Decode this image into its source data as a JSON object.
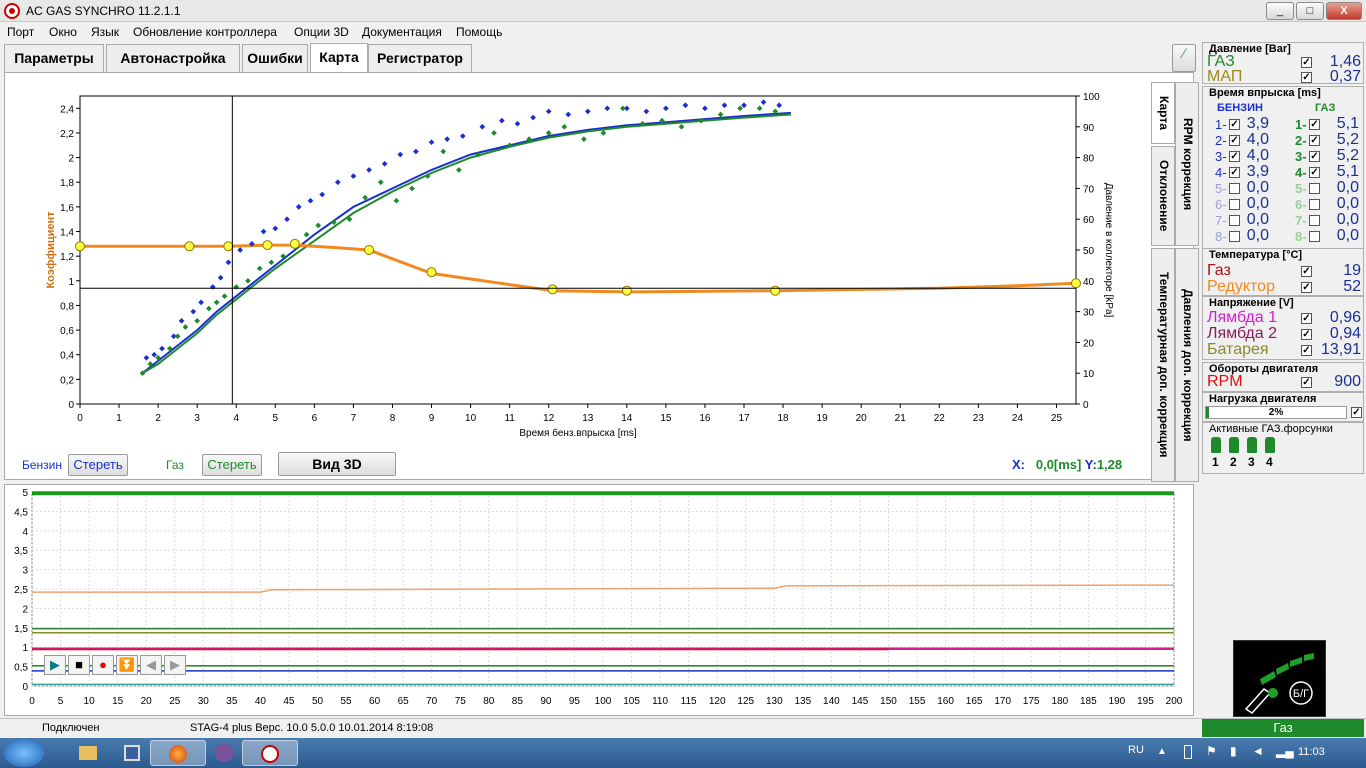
{
  "window": {
    "title": "AC GAS SYNCHRO  11.2.1.1",
    "min": "_",
    "max": "□",
    "close": "X"
  },
  "menu": [
    "Порт",
    "Окно",
    "Язык",
    "Обновление контроллера",
    "Опции 3D",
    "Документация",
    "Помощь"
  ],
  "tabs": [
    "Параметры",
    "Автонастройка",
    "Ошибки",
    "Карта",
    "Регистратор"
  ],
  "vtabs": [
    "Карта",
    "RPM коррекция",
    "Отклонение",
    "Давления доп. коррекция",
    "Температурная доп. коррекция"
  ],
  "map": {
    "ylabel": "Коэффициент",
    "xlabel": "Время бенз.впрыска [ms]",
    "y2label": "Давление в коллекторе [kPa]",
    "cursor": {
      "x_label": "X:",
      "x_value": "0,0[ms]",
      "y_label": "Y:",
      "y_value": "1,28"
    },
    "colors": {
      "petrol": "#1a2fcf",
      "gas": "#1f8a2b",
      "coef": "#f08a1e"
    }
  },
  "chart_data": [
    {
      "type": "scatter",
      "title": "",
      "xlabel": "Время бенз.впрыска [ms]",
      "ylabel": "Коэффициент",
      "y2label": "Давление в коллекторе [kPa]",
      "xlim": [
        0,
        25.5
      ],
      "ylim": [
        0,
        2.5
      ],
      "y2lim": [
        0,
        100
      ],
      "x_ticks": [
        0,
        1,
        2,
        3,
        4,
        5,
        6,
        7,
        8,
        9,
        10,
        11,
        12,
        13,
        14,
        15,
        16,
        17,
        18,
        19,
        20,
        21,
        22,
        23,
        24,
        25
      ],
      "y_ticks": [
        "0",
        "0,2",
        "0,4",
        "0,6",
        "0,8",
        "1",
        "1,2",
        "1,4",
        "1,6",
        "1,8",
        "2",
        "2,2",
        "2,4"
      ],
      "y2_ticks": [
        0,
        10,
        20,
        30,
        40,
        50,
        60,
        70,
        80,
        90,
        100
      ],
      "series": [
        {
          "name": "Бензин",
          "kind": "line",
          "x": [
            1.6,
            2,
            2.5,
            3,
            3.5,
            4,
            4.5,
            5,
            6,
            7,
            8,
            9,
            10,
            11,
            12,
            13,
            14,
            15,
            16,
            17,
            18.2
          ],
          "y2": [
            10,
            14,
            19,
            24,
            30,
            35,
            40,
            45,
            55,
            64,
            70,
            76,
            81,
            84,
            87,
            89,
            90.5,
            91.5,
            92.5,
            93.5,
            94.5
          ]
        },
        {
          "name": "Газ",
          "kind": "line",
          "x": [
            1.6,
            2,
            2.5,
            3,
            3.5,
            4,
            4.5,
            5,
            6,
            7,
            8,
            9,
            10,
            11,
            12,
            13,
            14,
            15,
            16,
            17,
            18.2
          ],
          "y2": [
            10,
            13,
            18,
            23,
            29,
            34,
            39,
            44,
            53,
            62,
            69,
            75,
            80,
            83.5,
            86.5,
            88.5,
            90,
            91,
            92,
            93,
            94
          ]
        },
        {
          "name": "Коэффициент",
          "kind": "line",
          "x": [
            0,
            2.8,
            3.8,
            4.8,
            5.5,
            6.5,
            7.4,
            9,
            12.1,
            14,
            17.8,
            20,
            22,
            24,
            25.5
          ],
          "y": [
            1.28,
            1.28,
            1.28,
            1.29,
            1.29,
            1.27,
            1.25,
            1.06,
            0.92,
            0.91,
            0.92,
            0.93,
            0.94,
            0.96,
            0.98
          ]
        },
        {
          "name": "Бензин",
          "kind": "points",
          "x": [
            1.7,
            1.9,
            2.1,
            2.4,
            2.6,
            2.9,
            3.1,
            3.4,
            3.6,
            3.8,
            4.1,
            4.4,
            4.7,
            5.0,
            5.3,
            5.6,
            5.9,
            6.2,
            6.6,
            7.0,
            7.4,
            7.8,
            8.2,
            8.6,
            9.0,
            9.4,
            9.8,
            10.3,
            10.8,
            11.2,
            11.6,
            12.0,
            12.5,
            13.0,
            13.5,
            14.0,
            14.5,
            15.0,
            15.5,
            16.0,
            16.5,
            17.0,
            17.5,
            17.9
          ],
          "y2": [
            15,
            16,
            18,
            22,
            27,
            30,
            33,
            38,
            41,
            46,
            50,
            52,
            56,
            57,
            60,
            64,
            66,
            68,
            72,
            74,
            76,
            78,
            81,
            82,
            85,
            86,
            87,
            90,
            92,
            91,
            93,
            95,
            94,
            95,
            96,
            96,
            95,
            96,
            97,
            96,
            97,
            97,
            98,
            97
          ]
        },
        {
          "name": "Газ",
          "kind": "points",
          "x": [
            1.6,
            1.8,
            2.0,
            2.3,
            2.5,
            2.7,
            3.0,
            3.3,
            3.5,
            3.7,
            4.0,
            4.3,
            4.6,
            4.9,
            5.2,
            5.5,
            5.8,
            6.1,
            6.5,
            6.9,
            7.3,
            7.7,
            8.1,
            8.5,
            8.9,
            9.3,
            9.7,
            10.2,
            10.6,
            11.0,
            11.5,
            12.0,
            12.4,
            12.9,
            13.4,
            13.9,
            14.4,
            14.9,
            15.4,
            15.9,
            16.4,
            16.9,
            17.4,
            17.8
          ],
          "y2": [
            10,
            13,
            15,
            18,
            22,
            25,
            27,
            31,
            33,
            35,
            38,
            40,
            44,
            46,
            48,
            52,
            55,
            58,
            59,
            60,
            67,
            72,
            66,
            70,
            74,
            82,
            76,
            81,
            88,
            84,
            86,
            88,
            90,
            86,
            88,
            96,
            91,
            92,
            90,
            92,
            94,
            96,
            96,
            95
          ]
        },
        {
          "name": "Коэффициент",
          "kind": "markers",
          "x": [
            0,
            2.8,
            3.8,
            4.8,
            5.5,
            7.4,
            9,
            12.1,
            14,
            17.8,
            25.5
          ],
          "y": [
            1.28,
            1.28,
            1.28,
            1.29,
            1.3,
            1.25,
            1.07,
            0.93,
            0.92,
            0.92,
            0.98
          ]
        }
      ],
      "crosshair": {
        "x": 3.9,
        "y": 0.94
      }
    },
    {
      "type": "line",
      "title": "",
      "xlim": [
        0,
        200
      ],
      "ylim": [
        0,
        5
      ],
      "x_ticks": [
        0,
        5,
        10,
        15,
        20,
        25,
        30,
        35,
        40,
        45,
        50,
        55,
        60,
        65,
        70,
        75,
        80,
        85,
        90,
        95,
        100,
        105,
        110,
        115,
        120,
        125,
        130,
        135,
        140,
        145,
        150,
        155,
        160,
        165,
        170,
        175,
        180,
        185,
        190,
        195,
        200
      ],
      "y_ticks": [
        "0",
        "0,5",
        "1",
        "1,5",
        "2",
        "2,5",
        "3",
        "3,5",
        "4",
        "4,5",
        "5"
      ],
      "series": [
        {
          "color": "#1a9a1a",
          "x": [
            0,
            200
          ],
          "y": [
            4.97,
            4.97
          ]
        },
        {
          "color": "#f0a070",
          "x": [
            0,
            40,
            42,
            130,
            132,
            200
          ],
          "y": [
            2.42,
            2.42,
            2.48,
            2.52,
            2.58,
            2.6
          ]
        },
        {
          "color": "#2c7a2c",
          "x": [
            0,
            200
          ],
          "y": [
            1.48,
            1.48
          ]
        },
        {
          "color": "#8a8a2a",
          "x": [
            0,
            200
          ],
          "y": [
            1.37,
            1.37
          ]
        },
        {
          "color": "#d21f8a",
          "x": [
            0,
            200
          ],
          "y": [
            0.96,
            0.96
          ]
        },
        {
          "color": "#e01010",
          "x": [
            0,
            150
          ],
          "y": [
            0.94,
            0.94
          ]
        },
        {
          "color": "#1f8a2b",
          "x": [
            0,
            200
          ],
          "y": [
            0.52,
            0.52
          ]
        },
        {
          "color": "#1a2fcf",
          "x": [
            0,
            200
          ],
          "y": [
            0.39,
            0.39
          ]
        },
        {
          "color": "#40a0a0",
          "x": [
            0,
            200
          ],
          "y": [
            0.04,
            0.04
          ]
        }
      ]
    }
  ],
  "mapcontrols": {
    "petrol_label": "Бензин",
    "petrol_clear": "Стереть",
    "gas_label": "Газ",
    "gas_clear": "Стереть",
    "view3d": "Вид 3D"
  },
  "pressure": {
    "header": "Давление [Bar]",
    "gas_label": "ГАЗ",
    "gas_value": "1,46",
    "map_label": "МАП",
    "map_value": "0,37"
  },
  "injection": {
    "header": "Время впрыска [ms]",
    "petrol_title": "БЕНЗИН",
    "gas_title": "ГАЗ",
    "rows": [
      {
        "n": "1-",
        "pv": "3,9",
        "gn": "1-",
        "gv": "5,1",
        "on": true
      },
      {
        "n": "2-",
        "pv": "4,0",
        "gn": "2-",
        "gv": "5,2",
        "on": true
      },
      {
        "n": "3-",
        "pv": "4,0",
        "gn": "3-",
        "gv": "5,2",
        "on": true
      },
      {
        "n": "4-",
        "pv": "3,9",
        "gn": "4-",
        "gv": "5,1",
        "on": true
      },
      {
        "n": "5-",
        "pv": "0,0",
        "gn": "5-",
        "gv": "0,0",
        "on": false
      },
      {
        "n": "6-",
        "pv": "0,0",
        "gn": "6-",
        "gv": "0,0",
        "on": false
      },
      {
        "n": "7-",
        "pv": "0,0",
        "gn": "7-",
        "gv": "0,0",
        "on": false
      },
      {
        "n": "8-",
        "pv": "0,0",
        "gn": "8-",
        "gv": "0,0",
        "on": false
      }
    ]
  },
  "temperature": {
    "header": "Температура  [°C]",
    "gas_label": "Газ",
    "gas_value": "19",
    "red_label": "Редуктор",
    "red_value": "52"
  },
  "voltage": {
    "header": "Напряжение [V]",
    "l1_label": "Лямбда 1",
    "l1_value": "0,96",
    "l2_label": "Лямбда 2",
    "l2_value": "0,94",
    "bat_label": "Батарея",
    "bat_value": "13,91"
  },
  "rpm": {
    "header": "Обороты двигателя",
    "label": "RPM",
    "value": "900"
  },
  "load": {
    "header": "Нагрузка двигателя",
    "value": "2%",
    "fraction": 0.02
  },
  "injectors": {
    "header": "Активные ГАЗ.форсунки",
    "items": [
      "1",
      "2",
      "3",
      "4"
    ]
  },
  "logo": {
    "text": "Б/Г"
  },
  "status": {
    "connected": "Подключен",
    "device": "STAG-4 plus   Верс. 10.0  5.0.0     10.01.2014 8:19:08",
    "mode": "Газ"
  },
  "taskbar": {
    "lang": "RU",
    "time": "11:03"
  }
}
